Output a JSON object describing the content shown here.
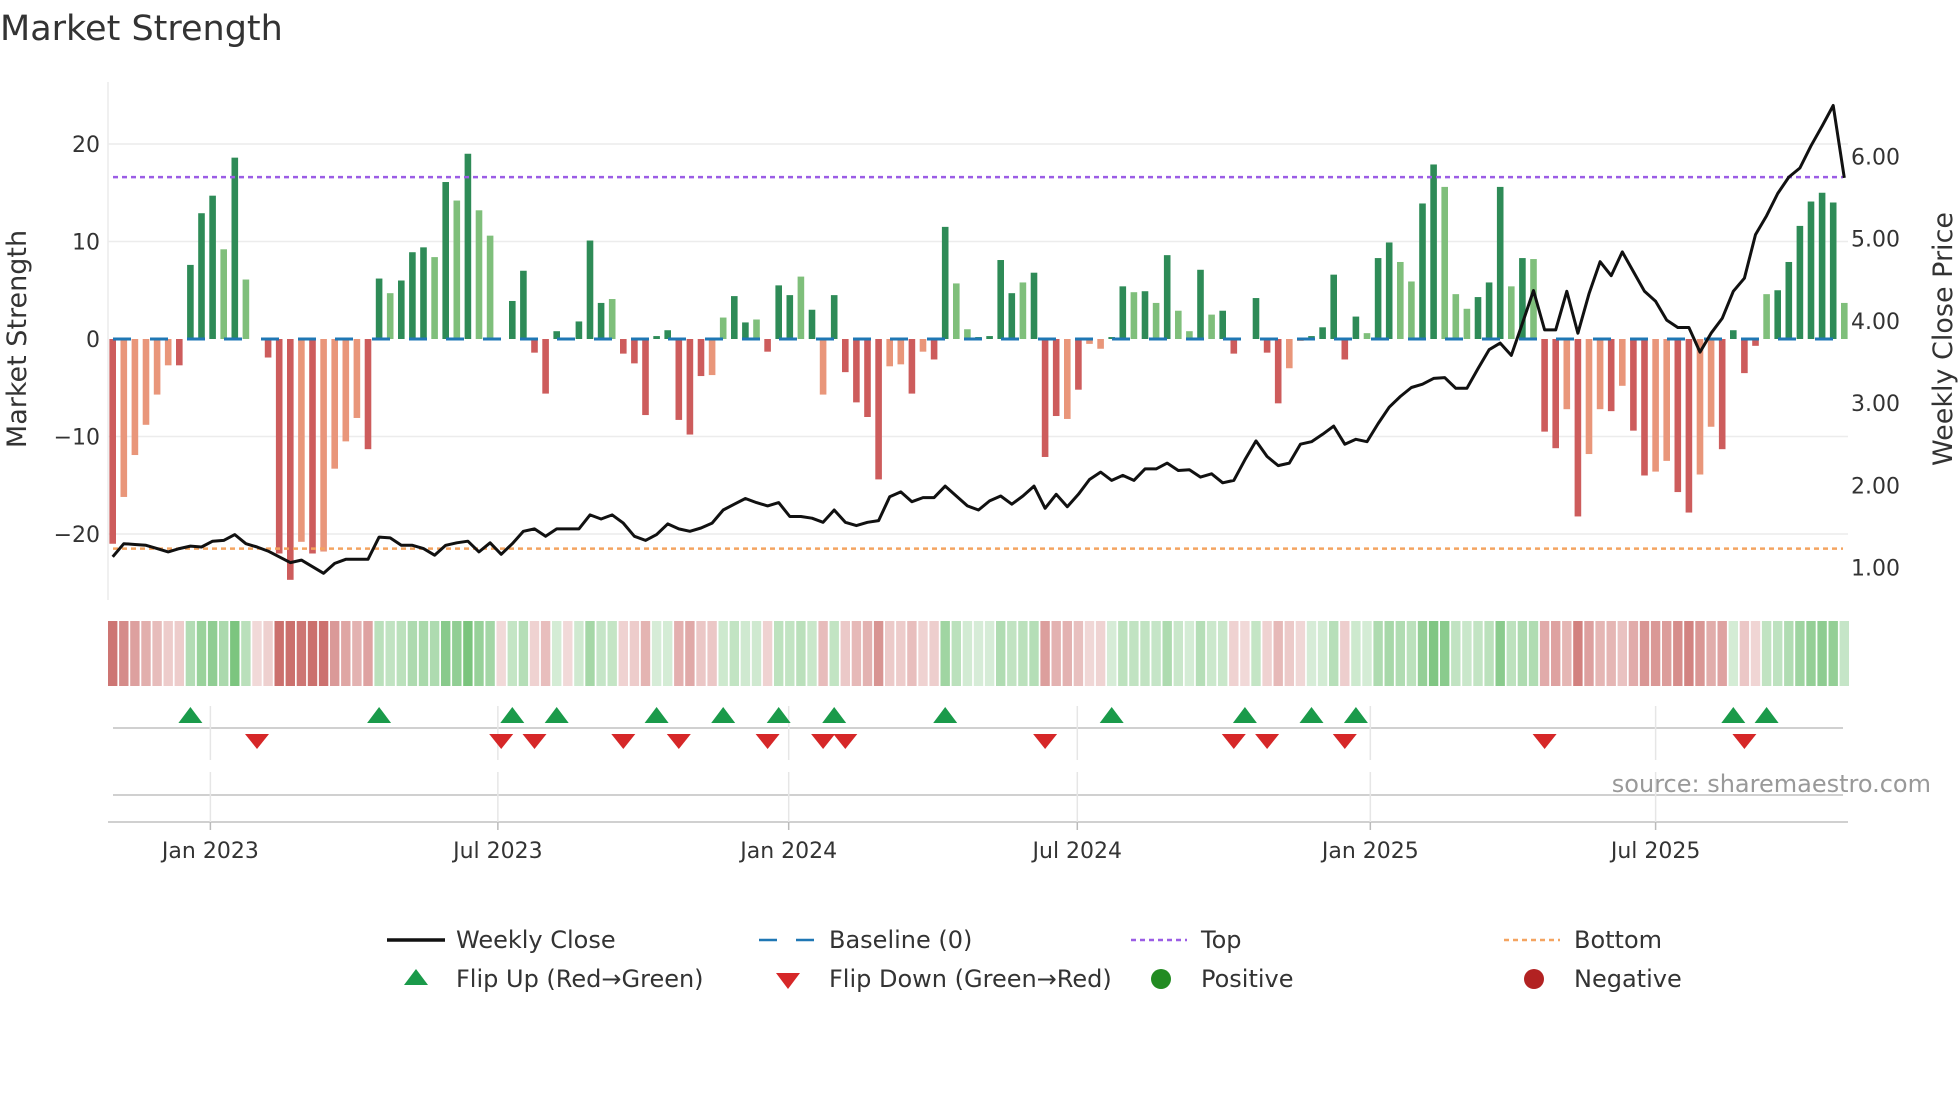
{
  "title": "Market Strength",
  "source": "source: sharemaestro.com",
  "colors": {
    "bar_pos_dark": "#2e8b57",
    "bar_pos_light": "#7fbf7b",
    "bar_neg_dark": "#cd5c5c",
    "bar_neg_light": "#e9967a",
    "strip_pos": "#4caf50",
    "strip_neg": "#c0504d",
    "close_line": "#111111",
    "baseline": "#1f77b4",
    "top": "#9b5de5",
    "bottom": "#f4a460",
    "flip_up": "#1a9a4a",
    "flip_down": "#d62728",
    "positive": "#228b22",
    "negative": "#b22222",
    "grid": "#ececec"
  },
  "chart_data": {
    "type": "bar",
    "title": "Market Strength",
    "y_left": {
      "label": "Market Strength",
      "ticks": [
        20,
        10,
        0,
        -10,
        -20
      ],
      "tick_labels": [
        "20",
        "10",
        "0",
        "−10",
        "−20"
      ],
      "range": [
        -26.8,
        26.4
      ]
    },
    "y_right": {
      "label": "Weekly Close Price",
      "ticks": [
        6,
        5,
        4,
        3,
        2,
        1
      ],
      "tick_labels": [
        "6.00",
        "5.00",
        "4.00",
        "3.00",
        "2.00",
        "1.00"
      ],
      "range": [
        0.6,
        6.91
      ]
    },
    "x": {
      "unit": "week index",
      "count": 157,
      "ticks": [
        {
          "label": "Jan 2023",
          "week": 8.8
        },
        {
          "label": "Jul 2023",
          "week": 34.7
        },
        {
          "label": "Jan 2024",
          "week": 60.9
        },
        {
          "label": "Jul 2024",
          "week": 86.9
        },
        {
          "label": "Jan 2025",
          "week": 113.3
        },
        {
          "label": "Jul 2025",
          "week": 139.0
        }
      ]
    },
    "levels": {
      "baseline": 0,
      "top": 16.6,
      "bottom": -21.5
    },
    "strength": [
      -21.0,
      -16.2,
      -11.9,
      -8.8,
      -5.7,
      -2.7,
      -2.7,
      7.6,
      12.9,
      14.7,
      9.2,
      18.6,
      6.1,
      0,
      -1.9,
      -22.0,
      -24.7,
      -20.8,
      -22.0,
      -21.8,
      -13.3,
      -10.5,
      -8.1,
      -11.3,
      6.2,
      4.7,
      6.0,
      8.9,
      9.4,
      8.4,
      16.1,
      14.2,
      19.0,
      13.2,
      10.6,
      0,
      3.9,
      7.0,
      -1.4,
      -5.6,
      0.8,
      0,
      1.8,
      10.1,
      3.7,
      4.1,
      -1.5,
      -2.5,
      -7.8,
      0.3,
      0.9,
      -8.3,
      -9.8,
      -3.8,
      -3.7,
      2.2,
      4.4,
      1.7,
      2.0,
      -1.3,
      5.5,
      4.5,
      6.4,
      3.0,
      -5.7,
      4.5,
      -3.4,
      -6.5,
      -8.0,
      -14.4,
      -2.8,
      -2.6,
      -5.6,
      -1.3,
      -2.1,
      11.5,
      5.7,
      1.0,
      0.2,
      0.3,
      8.1,
      4.7,
      5.8,
      6.8,
      -12.1,
      -7.9,
      -8.2,
      -5.2,
      -0.5,
      -1.0,
      0.2,
      5.4,
      4.8,
      4.9,
      3.7,
      8.6,
      2.9,
      0.8,
      7.1,
      2.5,
      2.9,
      -1.5,
      0,
      4.2,
      -1.4,
      -6.6,
      -3.0,
      -0.2,
      0.3,
      1.2,
      6.6,
      -2.1,
      2.3,
      0.6,
      8.3,
      9.9,
      7.9,
      5.9,
      13.9,
      17.9,
      15.6,
      4.6,
      3.1,
      4.3,
      5.8,
      15.6,
      5.4,
      8.3,
      8.2,
      -9.5,
      -11.2,
      -7.2,
      -18.2,
      -11.8,
      -7.2,
      -7.4,
      -4.8,
      -9.4,
      -14.0,
      -13.6,
      -12.5,
      -15.7,
      -17.8,
      -13.9,
      -9.0,
      -11.3,
      0.9,
      -3.5,
      -0.7,
      4.6,
      5.0,
      7.9,
      11.6,
      14.1,
      15.0,
      14.0,
      3.7
    ],
    "tone": "dllllldddd",
    "tone_rest": "ldlddddldllllddldddldldllddddddddddlddddddddllddldddldldddddlldlddllddddldddldllddldldlldlddddddlldddddlddllddllldddldlddldlldlddllddllddddlddddddll",
    "close": [
      1.13,
      1.29,
      1.28,
      1.27,
      1.23,
      1.19,
      1.23,
      1.26,
      1.25,
      1.32,
      1.33,
      1.4,
      1.29,
      1.25,
      1.2,
      1.13,
      1.06,
      1.09,
      1.01,
      0.93,
      1.05,
      1.1,
      1.1,
      1.1,
      1.37,
      1.36,
      1.27,
      1.27,
      1.23,
      1.15,
      1.27,
      1.3,
      1.32,
      1.19,
      1.3,
      1.16,
      1.29,
      1.44,
      1.47,
      1.38,
      1.47,
      1.47,
      1.47,
      1.64,
      1.59,
      1.64,
      1.54,
      1.38,
      1.33,
      1.4,
      1.53,
      1.47,
      1.44,
      1.48,
      1.54,
      1.7,
      1.77,
      1.84,
      1.79,
      1.75,
      1.79,
      1.62,
      1.62,
      1.6,
      1.55,
      1.7,
      1.55,
      1.51,
      1.55,
      1.57,
      1.86,
      1.92,
      1.8,
      1.85,
      1.85,
      1.99,
      1.87,
      1.75,
      1.7,
      1.81,
      1.87,
      1.77,
      1.87,
      1.99,
      1.72,
      1.89,
      1.74,
      1.89,
      2.07,
      2.16,
      2.06,
      2.12,
      2.06,
      2.2,
      2.2,
      2.27,
      2.18,
      2.19,
      2.1,
      2.14,
      2.03,
      2.06,
      2.31,
      2.54,
      2.35,
      2.24,
      2.27,
      2.5,
      2.53,
      2.62,
      2.72,
      2.5,
      2.56,
      2.53,
      2.75,
      2.95,
      3.08,
      3.19,
      3.23,
      3.3,
      3.31,
      3.18,
      3.18,
      3.42,
      3.65,
      3.73,
      3.58,
      3.97,
      4.37,
      3.89,
      3.89,
      4.36,
      3.85,
      4.33,
      4.72,
      4.55,
      4.84,
      4.6,
      4.36,
      4.24,
      4.01,
      3.92,
      3.92,
      3.62,
      3.85,
      4.03,
      4.36,
      4.52,
      5.05,
      5.28,
      5.55,
      5.75,
      5.86,
      6.13,
      6.37,
      6.62,
      5.74
    ],
    "flip_up": [
      7,
      24,
      36,
      40,
      49,
      55,
      60,
      65,
      75,
      90,
      102,
      108,
      112,
      146,
      149
    ],
    "flip_down": [
      13,
      35,
      38,
      46,
      51,
      59,
      64,
      66,
      84,
      101,
      104,
      111,
      129,
      147
    ],
    "legend": {
      "weekly_close": "Weekly Close",
      "baseline": "Baseline (0)",
      "top": "Top",
      "bottom": "Bottom",
      "flip_up": "Flip Up (Red→Green)",
      "flip_down": "Flip Down (Green→Red)",
      "positive": "Positive",
      "negative": "Negative"
    }
  }
}
